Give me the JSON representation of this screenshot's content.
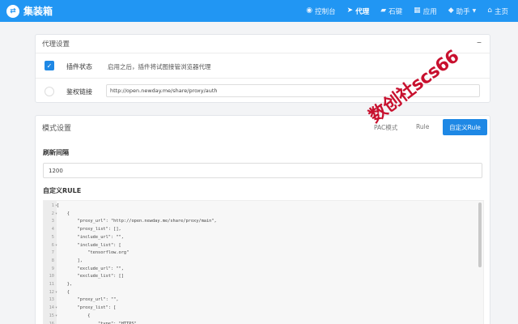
{
  "brand": {
    "logo_glyph": "⇄",
    "name": "集装箱"
  },
  "nav": [
    {
      "icon": "dashboard-icon",
      "glyph": "◉",
      "label": "控制台",
      "active": false
    },
    {
      "icon": "send-icon",
      "glyph": "➤",
      "label": "代理",
      "active": true
    },
    {
      "icon": "stone-icon",
      "glyph": "▰",
      "label": "石键",
      "active": false
    },
    {
      "icon": "apps-icon",
      "glyph": "▦",
      "label": "应用",
      "active": false
    },
    {
      "icon": "helper-icon",
      "glyph": "◆",
      "label": "助手",
      "active": false,
      "has_caret": true
    },
    {
      "icon": "home-icon",
      "glyph": "⌂",
      "label": "主页",
      "active": false
    }
  ],
  "proxy_settings": {
    "title": "代理设置",
    "collapse_glyph": "–",
    "plugin_status_label": "插件状态",
    "plugin_status_desc": "启用之后，插件将试图接管浏览器代理",
    "auth_link_label": "鉴权链接",
    "auth_link_value": "http://open.newday.me/share/proxy/auth"
  },
  "mode_settings": {
    "title": "模式设置",
    "tab_pac": "PAC模式",
    "tab_rule": "Rule",
    "tab_custom": "自定义Rule",
    "refresh_label": "刷新间隔",
    "refresh_value": "1200",
    "custom_rule_label": "自定义RULE"
  },
  "editor": {
    "lines": [
      {
        "n": "1",
        "fold": "▾",
        "text": "["
      },
      {
        "n": "2",
        "fold": "▾",
        "text": "    {"
      },
      {
        "n": "3",
        "fold": "",
        "text": "        \"proxy_url\": \"http://open.newday.me/share/proxy/main\","
      },
      {
        "n": "4",
        "fold": "",
        "text": "        \"proxy_list\": [],"
      },
      {
        "n": "5",
        "fold": "",
        "text": "        \"include_url\": \"\","
      },
      {
        "n": "6",
        "fold": "▾",
        "text": "        \"include_list\": ["
      },
      {
        "n": "7",
        "fold": "",
        "text": "            \"tensorflow.org\""
      },
      {
        "n": "8",
        "fold": "",
        "text": "        ],"
      },
      {
        "n": "9",
        "fold": "",
        "text": "        \"exclude_url\": \"\","
      },
      {
        "n": "10",
        "fold": "",
        "text": "        \"exclude_list\": []"
      },
      {
        "n": "11",
        "fold": "",
        "text": "    },"
      },
      {
        "n": "12",
        "fold": "▾",
        "text": "    {"
      },
      {
        "n": "13",
        "fold": "",
        "text": "        \"proxy_url\": \"\","
      },
      {
        "n": "14",
        "fold": "▾",
        "text": "        \"proxy_list\": ["
      },
      {
        "n": "15",
        "fold": "▾",
        "text": "            {"
      },
      {
        "n": "16",
        "fold": "",
        "text": "                \"type\": \"HTTPS\","
      }
    ]
  },
  "watermark": "数创社scs66",
  "colors": {
    "accent": "#2196f3",
    "button": "#1e88e5",
    "watermark": "#c8102e"
  }
}
